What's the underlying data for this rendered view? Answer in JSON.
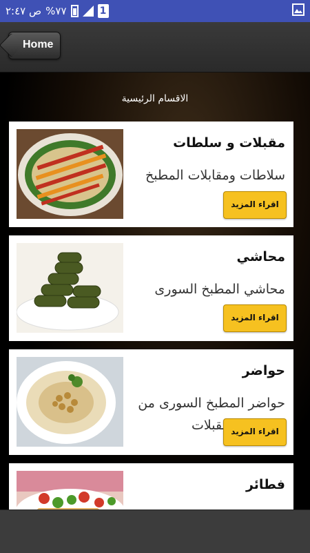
{
  "status_bar": {
    "time": "ص ٢:٤٧",
    "battery_percent": "%٧٧",
    "sim_label": "1"
  },
  "header": {
    "home_label": "Home"
  },
  "section_title": "الاقسام الرئيسية",
  "cards": [
    {
      "title": "مقبلات و سلطات",
      "description": "سلاطات ومقابلات المطبخ السوري",
      "button": "اقراء المزيد"
    },
    {
      "title": "محاشي",
      "description": "محاشي المطبخ السورى",
      "button": "اقراء المزيد"
    },
    {
      "title": "حواضر",
      "description": "حواضر المطبخ السورى من سلاطات ومقبلات",
      "button": "اقراء المزيد"
    },
    {
      "title": "فطائر",
      "description": "",
      "button": ""
    }
  ],
  "colors": {
    "status_bar": "#3f51b5",
    "button": "#f6c120"
  }
}
